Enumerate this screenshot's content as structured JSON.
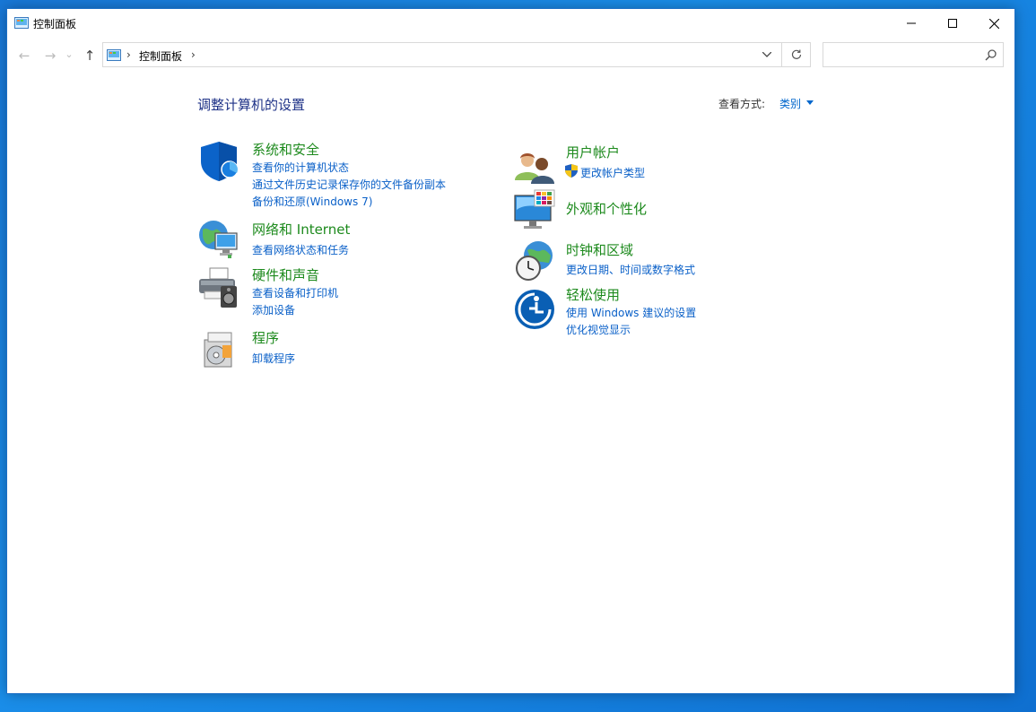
{
  "window": {
    "title": "控制面板"
  },
  "nav": {
    "back": "←",
    "forward": "→",
    "recent": "⌄",
    "up": "↑"
  },
  "address": {
    "breadcrumb": "控制面板",
    "separator": "›"
  },
  "search": {
    "placeholder": ""
  },
  "main": {
    "heading": "调整计算机的设置",
    "view_by_label": "查看方式:",
    "view_by_value": "类别"
  },
  "categories": {
    "security": {
      "title": "系统和安全",
      "links": [
        "查看你的计算机状态",
        "通过文件历史记录保存你的文件备份副本",
        "备份和还原(Windows 7)"
      ]
    },
    "network": {
      "title": "网络和 Internet",
      "links": [
        "查看网络状态和任务"
      ]
    },
    "hardware": {
      "title": "硬件和声音",
      "links": [
        "查看设备和打印机",
        "添加设备"
      ]
    },
    "programs": {
      "title": "程序",
      "links": [
        "卸载程序"
      ]
    },
    "users": {
      "title": "用户帐户",
      "links": [
        "更改帐户类型"
      ]
    },
    "appearance": {
      "title": "外观和个性化",
      "links": []
    },
    "clock": {
      "title": "时钟和区域",
      "links": [
        "更改日期、时间或数字格式"
      ]
    },
    "ease": {
      "title": "轻松使用",
      "links": [
        "使用 Windows 建议的设置",
        "优化视觉显示"
      ]
    }
  },
  "colors": {
    "heading": "#1e3287",
    "category_title": "#1d8a1d",
    "link": "#0a60c8",
    "desktop": "#1a8de8"
  }
}
